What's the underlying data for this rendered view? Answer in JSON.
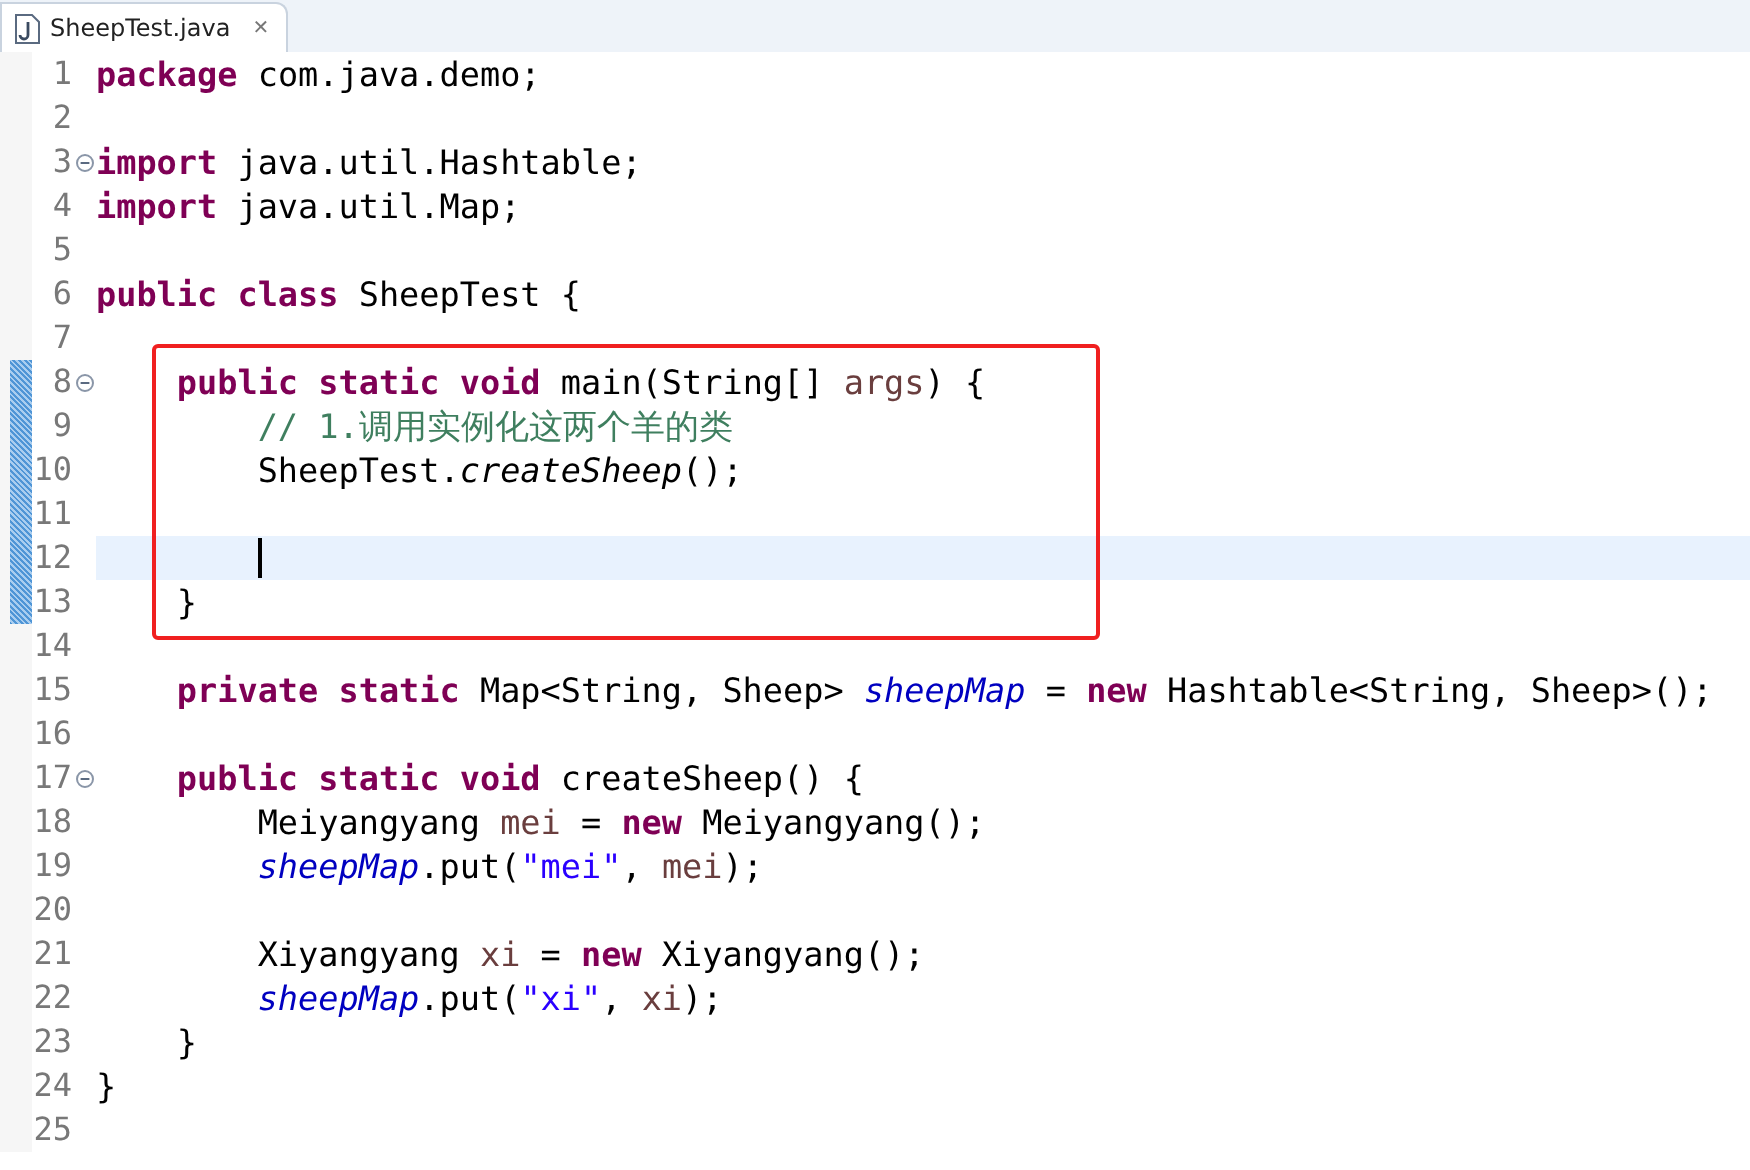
{
  "tab": {
    "title": "SheepTest.java",
    "close": "✕",
    "selected": true
  },
  "sections": [
    {
      "boxed": false,
      "changed": false,
      "lines": [
        {
          "number": "1",
          "foldable": false,
          "current": false,
          "tokens": [
            {
              "kind": "keyword",
              "text": "package"
            },
            {
              "kind": "plain",
              "text": " com.java.demo;"
            }
          ]
        },
        {
          "number": "2",
          "foldable": false,
          "current": false
        },
        {
          "number": "3",
          "foldable": true,
          "current": false,
          "tokens": [
            {
              "kind": "keyword",
              "text": "import"
            },
            {
              "kind": "plain",
              "text": " java.util.Hashtable;"
            }
          ]
        },
        {
          "number": "4",
          "foldable": false,
          "current": false,
          "tokens": [
            {
              "kind": "keyword",
              "text": "import"
            },
            {
              "kind": "plain",
              "text": " java.util.Map;"
            }
          ]
        },
        {
          "number": "5",
          "foldable": false,
          "current": false
        },
        {
          "number": "6",
          "foldable": false,
          "current": false,
          "tokens": [
            {
              "kind": "keyword",
              "text": "public class"
            },
            {
              "kind": "plain",
              "text": " SheepTest {"
            }
          ]
        },
        {
          "number": "7",
          "foldable": false,
          "current": false
        }
      ]
    },
    {
      "boxed": true,
      "changed": true,
      "lines": [
        {
          "number": "8",
          "foldable": true,
          "current": false,
          "tokens": [
            {
              "kind": "keyword",
              "text": "    public static void"
            },
            {
              "kind": "plain",
              "text": " main(String[] "
            },
            {
              "kind": "variable",
              "text": "args"
            },
            {
              "kind": "plain",
              "text": ") {"
            }
          ]
        },
        {
          "number": "9",
          "foldable": false,
          "current": false,
          "tokens": [
            {
              "kind": "comment",
              "text": "        // 1.调用实例化这两个羊的类"
            }
          ]
        },
        {
          "number": "10",
          "foldable": false,
          "current": false,
          "tokens": [
            {
              "kind": "plain",
              "text": "        SheepTest."
            },
            {
              "kind": "static-method",
              "text": "createSheep"
            },
            {
              "kind": "plain",
              "text": "();"
            }
          ]
        },
        {
          "number": "11",
          "foldable": false,
          "current": false
        },
        {
          "number": "12",
          "foldable": false,
          "current": true
        },
        {
          "number": "13",
          "foldable": false,
          "current": false,
          "tokens": [
            {
              "kind": "plain",
              "text": "    }"
            }
          ]
        }
      ]
    },
    {
      "boxed": false,
      "changed": false,
      "lines": [
        {
          "number": "14",
          "foldable": false,
          "current": false
        },
        {
          "number": "15",
          "foldable": false,
          "current": false,
          "tokens": [
            {
              "kind": "keyword",
              "text": "    private static"
            },
            {
              "kind": "plain",
              "text": " Map<String, Sheep> "
            },
            {
              "kind": "static-field",
              "text": "sheepMap"
            },
            {
              "kind": "plain",
              "text": " = "
            },
            {
              "kind": "keyword",
              "text": "new"
            },
            {
              "kind": "plain",
              "text": " Hashtable<String, Sheep>();"
            }
          ]
        },
        {
          "number": "16",
          "foldable": false,
          "current": false
        },
        {
          "number": "17",
          "foldable": true,
          "current": false,
          "tokens": [
            {
              "kind": "keyword",
              "text": "    public static void"
            },
            {
              "kind": "plain",
              "text": " createSheep() {"
            }
          ]
        },
        {
          "number": "18",
          "foldable": false,
          "current": false,
          "tokens": [
            {
              "kind": "plain",
              "text": "        Meiyangyang "
            },
            {
              "kind": "variable",
              "text": "mei"
            },
            {
              "kind": "plain",
              "text": " = "
            },
            {
              "kind": "keyword",
              "text": "new"
            },
            {
              "kind": "plain",
              "text": " Meiyangyang();"
            }
          ]
        },
        {
          "number": "19",
          "foldable": false,
          "current": false,
          "tokens": [
            {
              "kind": "static-field",
              "text": "        sheepMap"
            },
            {
              "kind": "plain",
              "text": ".put("
            },
            {
              "kind": "string",
              "text": "\"mei\""
            },
            {
              "kind": "plain",
              "text": ", "
            },
            {
              "kind": "variable",
              "text": "mei"
            },
            {
              "kind": "plain",
              "text": ");"
            }
          ]
        },
        {
          "number": "20",
          "foldable": false,
          "current": false
        },
        {
          "number": "21",
          "foldable": false,
          "current": false,
          "tokens": [
            {
              "kind": "plain",
              "text": "        Xiyangyang "
            },
            {
              "kind": "variable",
              "text": "xi"
            },
            {
              "kind": "plain",
              "text": " = "
            },
            {
              "kind": "keyword",
              "text": "new"
            },
            {
              "kind": "plain",
              "text": " Xiyangyang();"
            }
          ]
        },
        {
          "number": "22",
          "foldable": false,
          "current": false,
          "tokens": [
            {
              "kind": "static-field",
              "text": "        sheepMap"
            },
            {
              "kind": "plain",
              "text": ".put("
            },
            {
              "kind": "string",
              "text": "\"xi\""
            },
            {
              "kind": "plain",
              "text": ", "
            },
            {
              "kind": "variable",
              "text": "xi"
            },
            {
              "kind": "plain",
              "text": ");"
            }
          ]
        },
        {
          "number": "23",
          "foldable": false,
          "current": false,
          "tokens": [
            {
              "kind": "plain",
              "text": "    }"
            }
          ]
        },
        {
          "number": "24",
          "foldable": false,
          "current": false,
          "tokens": [
            {
              "kind": "plain",
              "text": "}"
            }
          ]
        },
        {
          "number": "25",
          "foldable": false,
          "current": false
        }
      ]
    }
  ]
}
